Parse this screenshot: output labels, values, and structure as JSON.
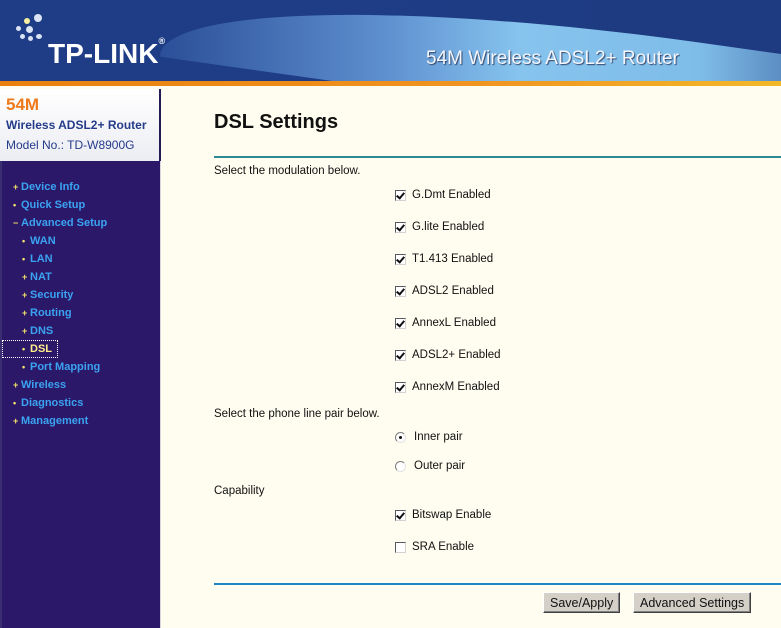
{
  "header": {
    "brand": "TP-LINK",
    "product_title": "54M Wireless ADSL2+ Router"
  },
  "device_info": {
    "speed": "54M",
    "model_name": "Wireless ADSL2+ Router",
    "model_no": "Model No.: TD-W8900G"
  },
  "sidebar": {
    "items": [
      {
        "label": "Device Info",
        "bullet": "+",
        "level": 0
      },
      {
        "label": "Quick Setup",
        "bullet": "•",
        "level": 0
      },
      {
        "label": "Advanced Setup",
        "bullet": "−",
        "level": 0
      },
      {
        "label": "WAN",
        "bullet": "•",
        "level": 1
      },
      {
        "label": "LAN",
        "bullet": "•",
        "level": 1
      },
      {
        "label": "NAT",
        "bullet": "+",
        "level": 1
      },
      {
        "label": "Security",
        "bullet": "+",
        "level": 1
      },
      {
        "label": "Routing",
        "bullet": "+",
        "level": 1
      },
      {
        "label": "DNS",
        "bullet": "+",
        "level": 1
      },
      {
        "label": "DSL",
        "bullet": "•",
        "level": 1,
        "active": true
      },
      {
        "label": "Port Mapping",
        "bullet": "•",
        "level": 1
      },
      {
        "label": "Wireless",
        "bullet": "+",
        "level": 0
      },
      {
        "label": "Diagnostics",
        "bullet": "•",
        "level": 0
      },
      {
        "label": "Management",
        "bullet": "+",
        "level": 0
      }
    ]
  },
  "main": {
    "title": "DSL Settings",
    "modulation_label": "Select the modulation below.",
    "modulations": [
      {
        "label": "G.Dmt Enabled",
        "checked": true
      },
      {
        "label": "G.lite Enabled",
        "checked": true
      },
      {
        "label": "T1.413 Enabled",
        "checked": true
      },
      {
        "label": "ADSL2 Enabled",
        "checked": true
      },
      {
        "label": "AnnexL Enabled",
        "checked": true
      },
      {
        "label": "ADSL2+ Enabled",
        "checked": true
      },
      {
        "label": "AnnexM Enabled",
        "checked": true
      }
    ],
    "pair_label": "Select the phone line pair below.",
    "pairs": [
      {
        "label": "Inner pair",
        "selected": true
      },
      {
        "label": "Outer pair",
        "selected": false
      }
    ],
    "capability_label": "Capability",
    "capabilities": [
      {
        "label": "Bitswap Enable",
        "checked": true
      },
      {
        "label": "SRA Enable",
        "checked": false
      }
    ],
    "buttons": {
      "save": "Save/Apply",
      "advanced": "Advanced Settings"
    }
  },
  "colors": {
    "sidebar_bg": "#2c1868",
    "nav_text": "#3aa3f2",
    "nav_active_text": "#ffee88",
    "accent_orange": "#ef7a1a",
    "banner_blue": "#1e3d86"
  }
}
